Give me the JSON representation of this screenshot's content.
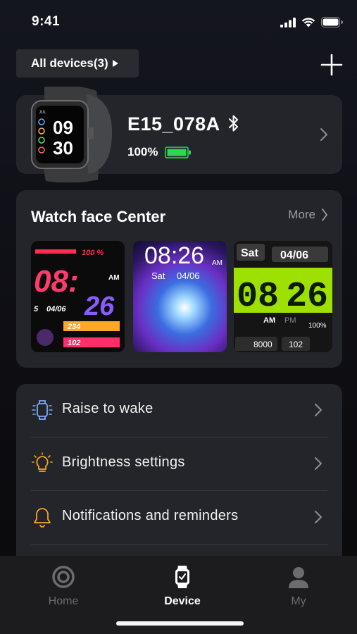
{
  "status_bar": {
    "time": "9:41"
  },
  "header": {
    "devices_label": "All devices(3)"
  },
  "device": {
    "name": "E15_078A",
    "battery": "100%"
  },
  "watch_preview": {
    "line1": "09",
    "line2": "30"
  },
  "watch_face_center": {
    "title": "Watch face Center",
    "more_label": "More",
    "faces": [
      {
        "battery": "100 %",
        "hour": "08:",
        "minute": "26",
        "date_day": "5",
        "date": "04/06",
        "steps": "234",
        "heart": "102"
      },
      {
        "time": "08:26",
        "ampm": "AM",
        "day": "Sat",
        "date": "04/06"
      },
      {
        "day": "Sat",
        "date": "04/06",
        "hour": "08",
        "minute": "26",
        "am": "AM",
        "pm": "PM",
        "battery": "100%",
        "steps": "8000",
        "heart": "102"
      }
    ]
  },
  "settings": {
    "items": [
      {
        "label": "Raise to wake"
      },
      {
        "label": "Brightness settings"
      },
      {
        "label": "Notifications and reminders"
      }
    ]
  },
  "tabs": [
    {
      "label": "Home"
    },
    {
      "label": "Device"
    },
    {
      "label": "My"
    }
  ],
  "colors": {
    "accent_active": "#ffffff",
    "inactive": "#6b6b70",
    "battery_green": "#2fd64f",
    "menu_icon_blue": "#7fa8ff",
    "menu_icon_orange": "#f5a623"
  }
}
